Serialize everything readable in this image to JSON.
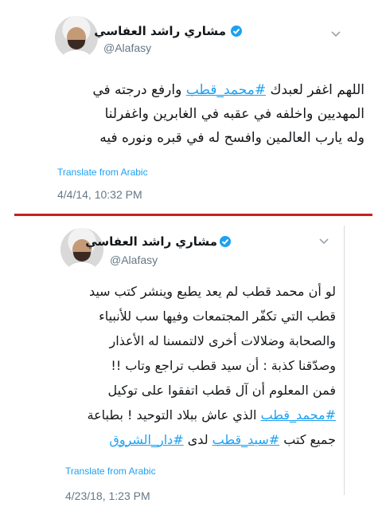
{
  "tweets": [
    {
      "display_name": "مشاري راشد العفاسي",
      "handle": "@Alafasy",
      "lines": [
        [
          {
            "t": "اللهم اغفر لعبدك "
          },
          {
            "t": "#محمد_قطب",
            "tag": true
          },
          {
            "t": " وارفع درجته في"
          }
        ],
        [
          {
            "t": "المهديين واخلفه في عقبه في الغابرين واغفرلنا"
          }
        ],
        [
          {
            "t": "وله يارب العالمين وافسح له في قبره ونوره فيه"
          }
        ]
      ],
      "translate_label": "Translate from Arabic",
      "timestamp": "4/4/14, 10:32 PM"
    },
    {
      "display_name": "مشاري راشد العفاسي",
      "handle": "@Alafasy",
      "lines": [
        [
          {
            "t": "لو أن محمد قطب لم يعد يطبع وينشر كتب سيد"
          }
        ],
        [
          {
            "t": "قطب التي تكفّر المجتمعات وفيها سب للأنبياء"
          }
        ],
        [
          {
            "t": "والصحابة وضلالات أخرى لالتمسنا له الأعذار"
          }
        ],
        [
          {
            "t": "وصدّقنا كذبة : أن سيد قطب تراجع وتاب !!"
          }
        ],
        [
          {
            "t": "فمن المعلوم أن آل قطب اتفقوا على توكيل"
          }
        ],
        [
          {
            "t": "#محمد_قطب",
            "tag": true
          },
          {
            "t": " الذي عاش ببلاد التوحيد ! بطباعة"
          }
        ],
        [
          {
            "t": "جميع كتب "
          },
          {
            "t": "#سيد_قطب",
            "tag": true
          },
          {
            "t": " لدى "
          },
          {
            "t": "#دار_الشروق",
            "tag": true
          }
        ]
      ],
      "translate_label": "Translate from Arabic",
      "timestamp": "4/23/18, 1:23 PM"
    }
  ],
  "icons": {
    "verified": "verified-badge-icon",
    "caret": "chevron-down-icon"
  },
  "colors": {
    "link": "#1da1f2",
    "text": "#14171a",
    "muted": "#657786",
    "divider": "#c8201e"
  }
}
